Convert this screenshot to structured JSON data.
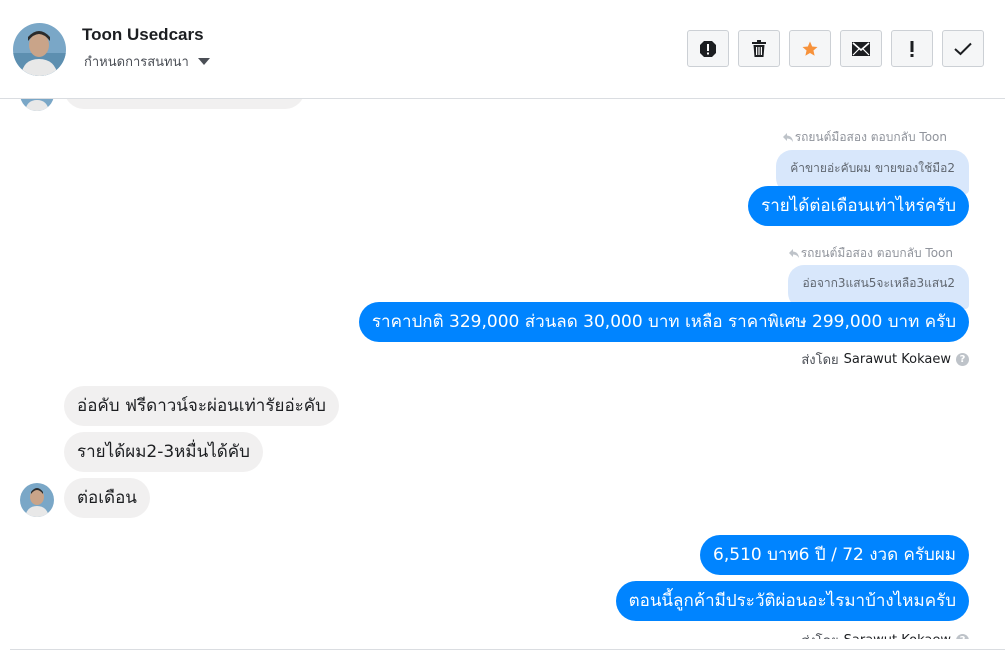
{
  "header": {
    "contact_name": "Toon Usedcars",
    "conversation_settings_label": "กำหนดการสนทนา"
  },
  "toolbar": {
    "buttons": [
      {
        "name": "report-spam-button",
        "icon": "exclamation-circle-icon"
      },
      {
        "name": "delete-button",
        "icon": "trash-icon"
      },
      {
        "name": "star-button",
        "icon": "star-icon",
        "color": "#f7923b"
      },
      {
        "name": "mark-unread-button",
        "icon": "envelope-icon"
      },
      {
        "name": "follow-up-button",
        "icon": "exclamation-icon"
      },
      {
        "name": "mark-done-button",
        "icon": "check-icon"
      }
    ]
  },
  "messages": {
    "reply1_meta": "รถยนต์มือสอง ตอบกลับ Toon",
    "reply1_quote": "ค้าขายอ่ะคับผม ขายของใช้มือ2",
    "reply1_text": "รายได้ต่อเดือนเท่าไหร่ครับ",
    "reply2_meta": "รถยนต์มือสอง ตอบกลับ Toon",
    "reply2_quote": "อ่อจาก3แสน5จะเหลือ3แสน2",
    "reply2_text": "ราคาปกติ 329,000 ส่วนลด 30,000 บาท เหลือ ราคาพิเศษ 299,000 บาท ครับ",
    "sent_by_prefix": "ส่งโดย",
    "sent_by_name": "Sarawut Kokaew",
    "incoming": [
      "อ่อคับ ฟรีดาวน์จะผ่อนเท่ารัยอ่ะคับ",
      "รายได้ผม2-3หมื่นได้คับ",
      "ต่อเดือน"
    ],
    "outgoing_last": [
      "6,510 บาท6 ปี / 72 งวด ครับผม",
      "ตอนนี้ลูกค้ามีประวัติผ่อนอะไรมาบ้างไหมครับ"
    ]
  },
  "colors": {
    "outgoing_bubble": "#0084ff",
    "incoming_bubble": "#f1f0f0",
    "quote_bubble": "#d8e7fb",
    "star": "#f7923b"
  }
}
